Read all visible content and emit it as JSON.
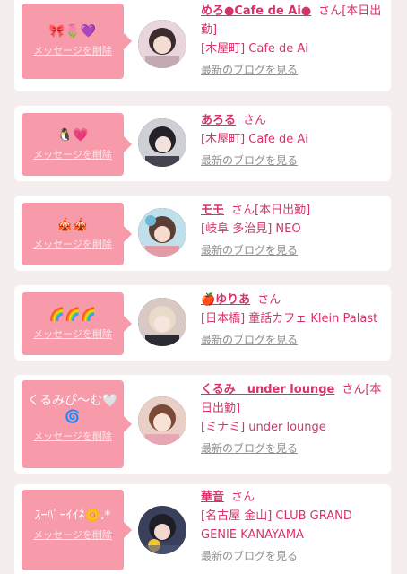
{
  "delete_label": "メッセージを削除",
  "blog_label": "最新のブログを見る",
  "honorific": "さん",
  "colors": {
    "accent": "#d8326a",
    "bubble": "#f79aa9",
    "background": "#f4eeef"
  },
  "cards": [
    {
      "message": "🎀🌷💜",
      "name": "めろ●Cafe de Ai●",
      "status": "[本日出勤]",
      "shop": "[木屋町] Cafe de Ai",
      "avatar_icon": "profile-photo"
    },
    {
      "message": "🐧💗",
      "name": "あろる",
      "status": "",
      "shop": "[木屋町] Cafe de Ai",
      "avatar_icon": "profile-photo"
    },
    {
      "message": "🎪🎪",
      "name": "モモ",
      "status": "[本日出勤]",
      "shop": "[岐阜 多治見] NEO",
      "avatar_icon": "profile-photo"
    },
    {
      "message": "🌈🌈🌈",
      "name": "🍎ゆりあ",
      "status": "",
      "shop": "[日本橋] 童話カフェ Klein Palast",
      "avatar_icon": "profile-photo"
    },
    {
      "message": "くるみぴ〜む🤍\n🌀",
      "name": "くるみ　under lounge",
      "status": "[本日出勤]",
      "shop": "[ミナミ] under lounge",
      "avatar_icon": "profile-photo"
    },
    {
      "message": "ｽｰﾊﾟｰｲｲﾈ🌼.*",
      "name": "華音",
      "status": "",
      "shop": "[名古屋 金山] CLUB GRAND GENIE KANAYAMA",
      "avatar_icon": "profile-photo"
    }
  ]
}
